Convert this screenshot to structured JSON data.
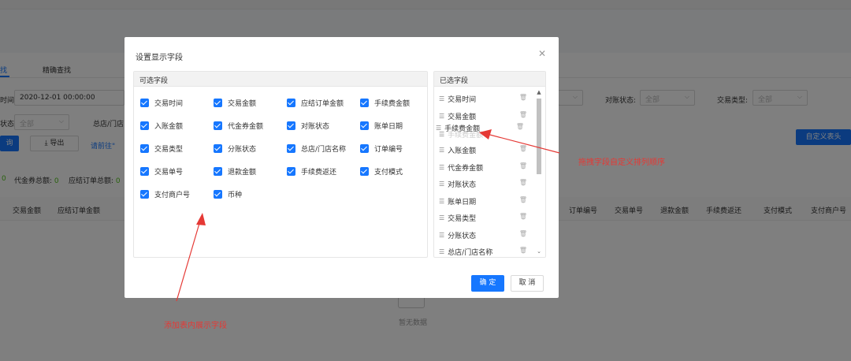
{
  "background": {
    "tabs": [
      "找",
      "精确查找"
    ],
    "time_label": "时间:",
    "time_value": "2020-12-01 00:00:00",
    "status_label": "状态:",
    "status_value": "全部",
    "store_label": "总店/门店",
    "export_label": "导出",
    "query_label": "询",
    "goto_link": "请前往\"",
    "reconcile_label": "对账状态:",
    "reconcile_value": "全部",
    "trade_type_label": "交易类型:",
    "trade_type_value": "全部",
    "custom_header_btn": "自定义表头",
    "summary_1_num": "0",
    "summary_2_label": "代金券总额:",
    "summary_2_num": "0",
    "summary_3_label": "应结订单总额:",
    "summary_3_num": "0",
    "table_headers_left": [
      "交易金额",
      "应结订单金额"
    ],
    "table_headers_right": [
      "订单编号",
      "交易单号",
      "退款金额",
      "手续费返还",
      "支付模式",
      "支付商户号"
    ],
    "empty_text": "暂无数据"
  },
  "modal": {
    "title": "设置显示字段",
    "left_panel_title": "可选字段",
    "right_panel_title": "已选字段",
    "available_fields": [
      "交易时间",
      "交易金额",
      "应结订单金额",
      "手续费金额",
      "入账金额",
      "代金券金额",
      "对账状态",
      "账单日期",
      "交易类型",
      "分账状态",
      "总店/门店名称",
      "订单编号",
      "交易单号",
      "退款金额",
      "手续费返还",
      "支付模式",
      "支付商户号",
      "币种"
    ],
    "selected_fields": [
      "交易时间",
      "交易金额",
      "手续费金额",
      "手续费金额",
      "入账金额",
      "代金券金额",
      "对账状态",
      "账单日期",
      "交易类型",
      "分账状态",
      "总店/门店名称"
    ],
    "ok_label": "确 定",
    "cancel_label": "取 消"
  },
  "annotations": {
    "drag_hint": "拖拽字段自定义排列顺序",
    "add_hint": "添加表内展示字段"
  },
  "colors": {
    "primary": "#1677ff",
    "annotation": "#e53935"
  }
}
